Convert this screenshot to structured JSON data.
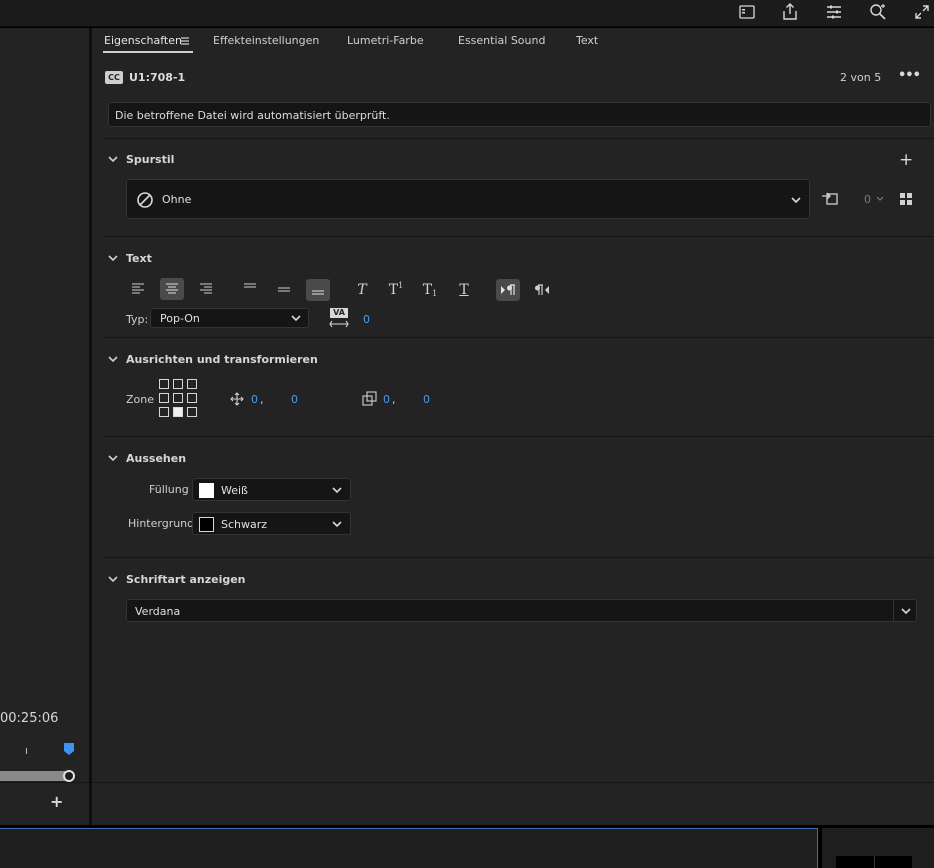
{
  "tabs": [
    "Eigenschaften",
    "Effekteinstellungen",
    "Lumetri-Farbe",
    "Essential Sound",
    "Text"
  ],
  "caption": {
    "badge": "CC",
    "id": "U1:708-1",
    "counter": "2 von 5",
    "more": "•••",
    "text": "Die betroffene Datei wird automatisiert  überprüft."
  },
  "sections": {
    "spurstil": {
      "title": "Spurstil",
      "value": "Ohne",
      "count": "0"
    },
    "text": {
      "title": "Text",
      "type_label": "Typ:",
      "type_value": "Pop-On",
      "tracking_icon_text": "VA",
      "tracking_value": "0"
    },
    "align": {
      "title": "Ausrichten und transformieren",
      "zone_label": "Zone",
      "pos_x": "0",
      "pos_y": "0",
      "size_x": "0",
      "size_y": "0",
      "separator": ","
    },
    "appearance": {
      "title": "Aussehen",
      "fill_label": "Füllung",
      "fill_value": "Weiß",
      "fill_color": "#ffffff",
      "bg_label": "Hintergrund",
      "bg_value": "Schwarz",
      "bg_color": "#000000"
    },
    "font": {
      "title": "Schriftart anzeigen",
      "value": "Verdana"
    }
  },
  "left": {
    "timecode": "00:25:06"
  }
}
